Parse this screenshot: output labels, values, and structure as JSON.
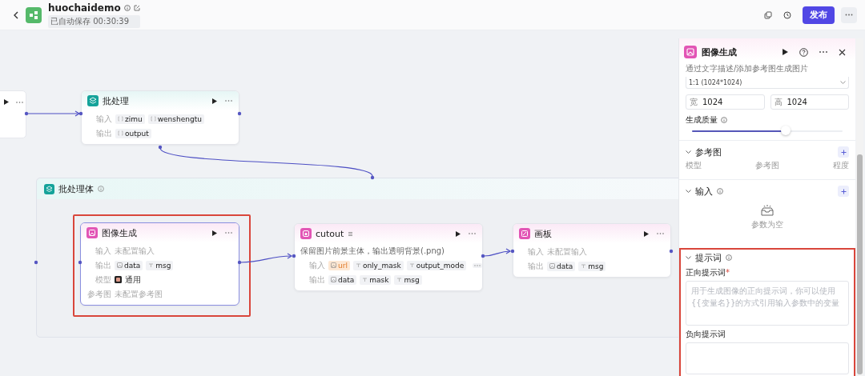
{
  "header": {
    "title": "huochaidemo",
    "save_status": "已自动保存 00:30:39",
    "publish_button": "发布"
  },
  "canvas": {
    "group": {
      "title": "批处理体"
    },
    "nodes": [
      {
        "kind": "batch",
        "title": "批处理",
        "selected": false,
        "rows": [
          {
            "kind": "tags",
            "label": "输入",
            "tags": [
              {
                "kind": "array",
                "text": "zimu"
              },
              {
                "kind": "array",
                "text": "wenshengtu"
              }
            ]
          },
          {
            "kind": "tags",
            "label": "输出",
            "tags": [
              {
                "kind": "array",
                "text": "output"
              }
            ]
          }
        ]
      },
      {
        "kind": "image",
        "title": "图像生成",
        "selected": true,
        "rows": [
          {
            "kind": "empty",
            "label": "输入",
            "text": "未配置输入"
          },
          {
            "kind": "tags",
            "label": "输出",
            "tags": [
              {
                "kind": "image",
                "text": "data"
              },
              {
                "kind": "string",
                "text": "msg"
              }
            ]
          },
          {
            "kind": "model",
            "label": "模型",
            "text": "通用"
          },
          {
            "kind": "empty",
            "label": "参考图",
            "text": "未配置参考图"
          }
        ]
      },
      {
        "kind": "cutout",
        "title": "cutout",
        "selected": false,
        "description": "保留图片前景主体，输出透明背景(.png)",
        "rows": [
          {
            "kind": "tags",
            "label": "输入",
            "more": true,
            "tags": [
              {
                "kind": "image",
                "text": "url",
                "warning": true
              },
              {
                "kind": "string",
                "text": "only_mask",
                "warning": false
              },
              {
                "kind": "string",
                "text": "output_mode",
                "warning": false
              }
            ]
          },
          {
            "kind": "tags",
            "label": "输出",
            "tags": [
              {
                "kind": "image",
                "text": "data"
              },
              {
                "kind": "string",
                "text": "mask"
              },
              {
                "kind": "string",
                "text": "msg"
              }
            ]
          }
        ]
      },
      {
        "kind": "board",
        "title": "画板",
        "selected": false,
        "rows": [
          {
            "kind": "empty",
            "label": "输入",
            "text": "未配置输入"
          },
          {
            "kind": "tags",
            "label": "输出",
            "tags": [
              {
                "kind": "image",
                "text": "data"
              },
              {
                "kind": "string",
                "text": "msg"
              }
            ]
          }
        ]
      }
    ]
  },
  "panel": {
    "title": "图像生成",
    "description": "通过文字描述/添加参考图生成图片",
    "ratio": "1:1 (1024*1024)",
    "width": {
      "label": "宽",
      "value": "1024"
    },
    "height": {
      "label": "高",
      "value": "1024"
    },
    "quality": {
      "label": "生成质量",
      "level": 0.62
    },
    "reference": {
      "title": "参考图",
      "columns": [
        "模型",
        "参考图",
        "程度"
      ]
    },
    "inputs": {
      "title": "输入",
      "empty_text": "参数为空"
    },
    "prompt": {
      "title": "提示词",
      "positive_label": "正向提示词",
      "required_mark": "*",
      "positive_placeholder": "用于生成图像的正向提示词，你可以使用{{变量名}}的方式引用输入参数中的变量",
      "negative_label": "负向提示词"
    }
  }
}
